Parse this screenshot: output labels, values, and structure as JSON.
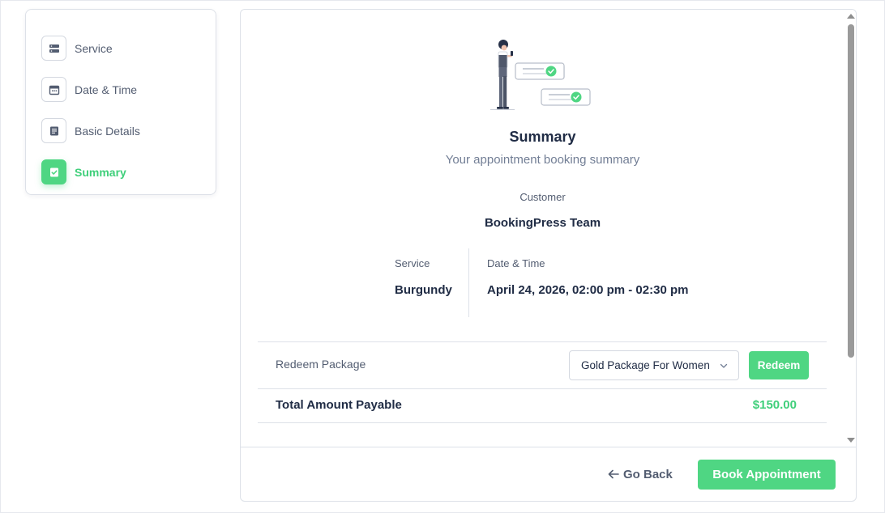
{
  "colors": {
    "accent": "#4fd683",
    "accent_text": "#3fcf7a",
    "text_dark": "#202c45",
    "text_muted": "#535d71",
    "border": "#dde1e8"
  },
  "sidebar": {
    "steps": [
      {
        "label": "Service",
        "icon": "service-icon",
        "active": false
      },
      {
        "label": "Date & Time",
        "icon": "calendar-icon",
        "active": false
      },
      {
        "label": "Basic Details",
        "icon": "document-icon",
        "active": false
      },
      {
        "label": "Summary",
        "icon": "check-clipboard-icon",
        "active": true
      }
    ]
  },
  "summary": {
    "title": "Summary",
    "subtitle": "Your appointment booking summary",
    "customer_label": "Customer",
    "customer_value": "BookingPress Team",
    "service_label": "Service",
    "service_value": "Burgundy",
    "datetime_label": "Date & Time",
    "datetime_value": "April 24, 2026, 02:00 pm - 02:30 pm"
  },
  "redeem": {
    "label": "Redeem Package",
    "selected_package": "Gold Package For Women",
    "button_label": "Redeem"
  },
  "total": {
    "label": "Total Amount Payable",
    "value": "$150.00"
  },
  "footer": {
    "back_label": "Go Back",
    "book_label": "Book Appointment"
  }
}
